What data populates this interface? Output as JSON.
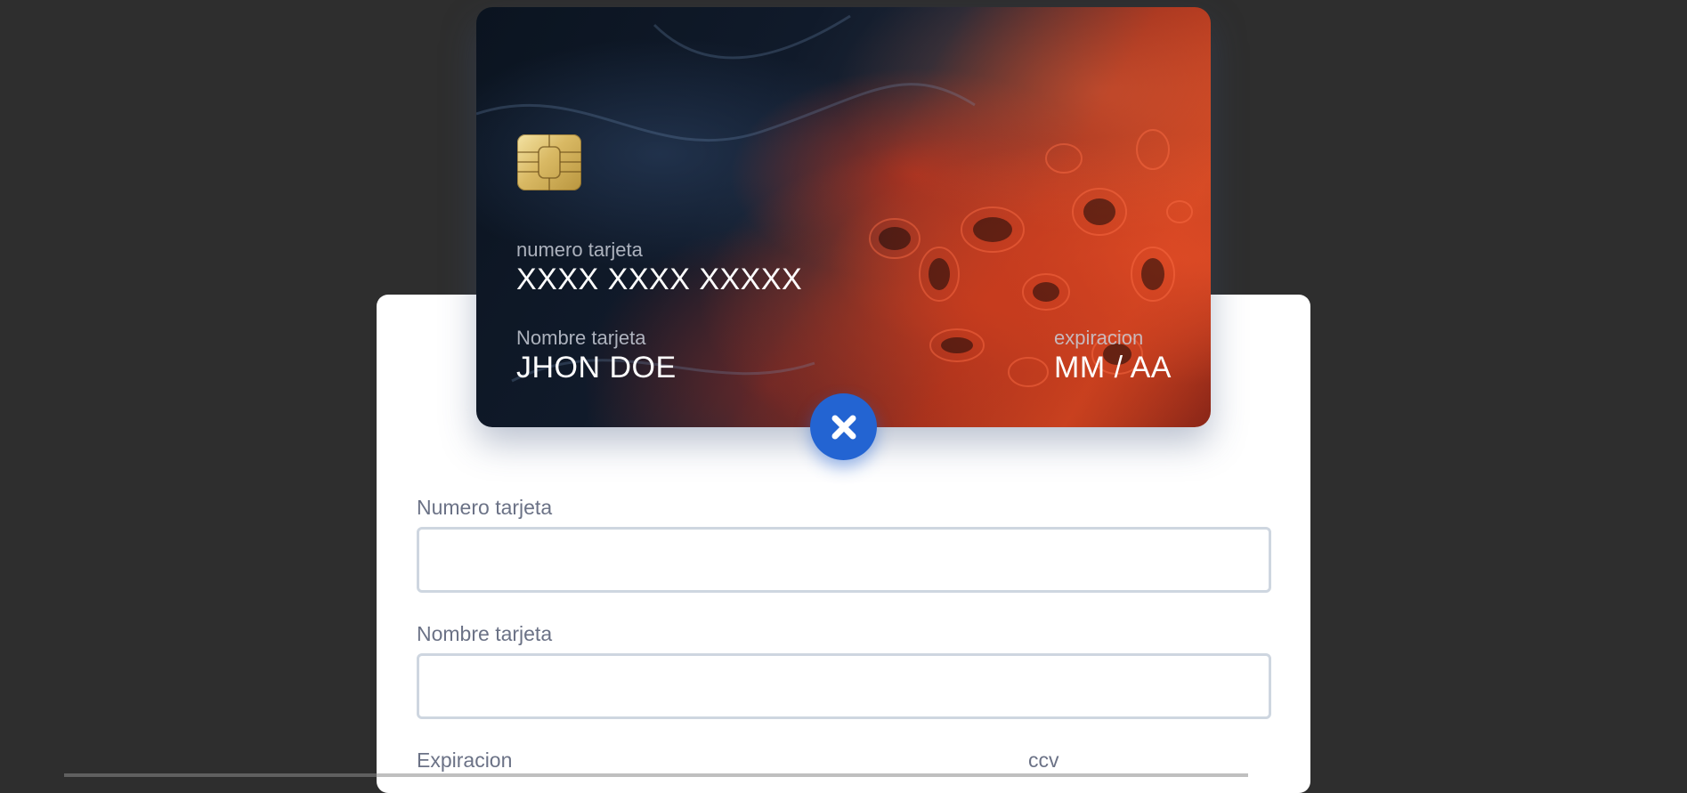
{
  "card": {
    "number_label": "numero tarjeta",
    "number_value": "XXXX XXXX XXXXX",
    "name_label": "Nombre tarjeta",
    "name_value": "JHON DOE",
    "expiry_label": "expiracion",
    "expiry_value": "MM / AA"
  },
  "close_button": {
    "icon": "close-icon",
    "color": "#2364d2"
  },
  "form": {
    "number_field": {
      "label": "Numero tarjeta",
      "value": "",
      "placeholder": ""
    },
    "name_field": {
      "label": "Nombre tarjeta",
      "value": "",
      "placeholder": ""
    },
    "expiry_label": "Expiracion",
    "ccv_label": "ccv"
  },
  "colors": {
    "background": "#2e2e2e",
    "panel": "#ffffff",
    "accent": "#2364d2",
    "label": "#6b7286",
    "input_border": "#ced6e0"
  }
}
